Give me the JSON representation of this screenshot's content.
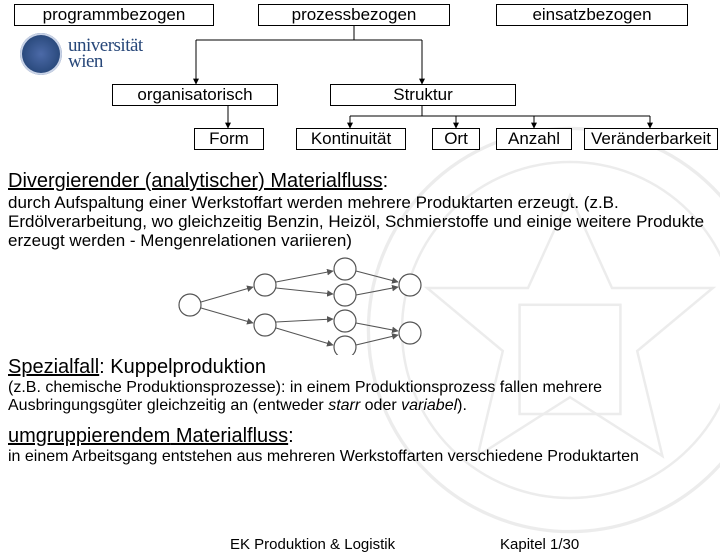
{
  "tree": {
    "top": [
      "programmbezogen",
      "prozessbezogen",
      "einsatzbezogen"
    ],
    "mid": [
      "organisatorisch",
      "Struktur"
    ],
    "leaves": [
      "Form",
      "Kontinuität",
      "Ort",
      "Anzahl",
      "Veränderbarkeit"
    ]
  },
  "logo": {
    "line1": "universität",
    "line2": "wien"
  },
  "sections": {
    "s1": {
      "title_a": "Divergierender (analytischer) Materialfluss",
      "colon": ":",
      "body": "durch Aufspaltung einer Werkstoffart werden mehrere Produktarten erzeugt. (z.B. Erdölverarbeitung, wo gleichzeitig Benzin, Heizöl, Schmierstoffe und einige weitere Produkte erzeugt werden - Mengenrelationen variieren)"
    },
    "s2": {
      "title_a": "Spezialfall",
      "title_b": ": Kuppelproduktion",
      "body_a": "(z.B. chemische Produktionsprozesse): in einem Produktionsprozess fallen mehrere Ausbringungsgüter gleichzeitig an (entweder ",
      "body_starr": "starr",
      "body_oder": " oder ",
      "body_var": "variabel",
      "body_end": ")."
    },
    "s3": {
      "title_a": "umgruppierendem",
      "title_b": " Materialfluss",
      "colon": ":",
      "body": "in einem Arbeitsgang entstehen aus mehreren Werkstoffarten verschiedene Produktarten"
    }
  },
  "footer": {
    "left": "EK Produktion & Logistik",
    "right": "Kapitel 1/30"
  }
}
